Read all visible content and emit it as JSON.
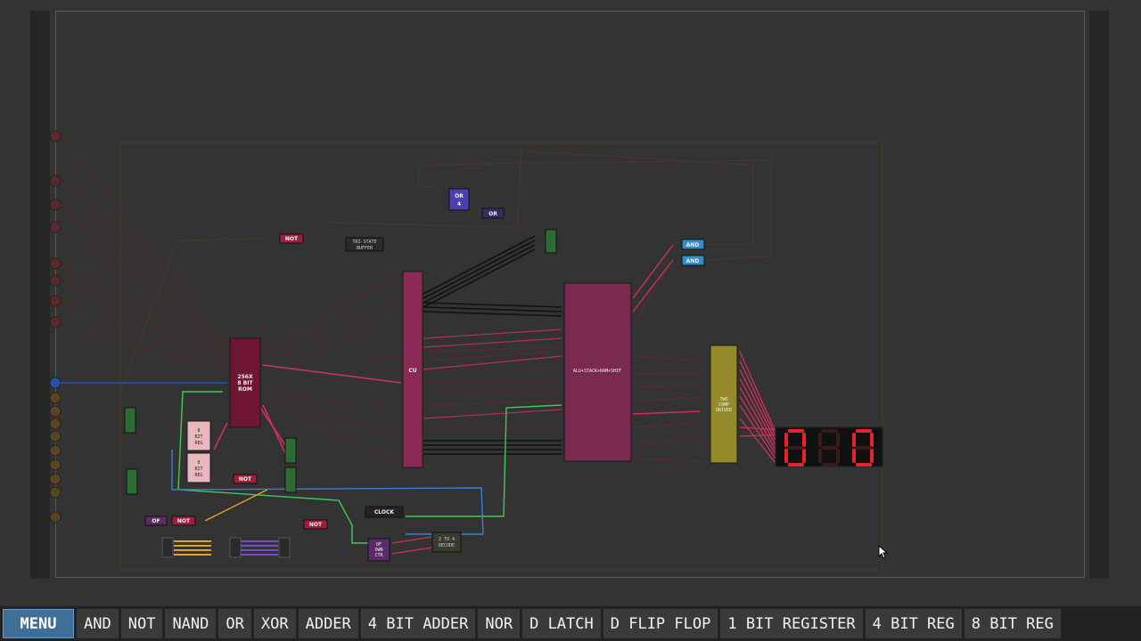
{
  "toolbar": {
    "menu_label": "MENU",
    "items": [
      "AND",
      "NOT",
      "NAND",
      "OR",
      "XOR",
      "ADDER",
      "4 BIT ADDER",
      "NOR",
      "D LATCH",
      "D FLIP FLOP",
      "1 BIT REGISTER",
      "4 BIT REG",
      "8 BIT REG"
    ]
  },
  "chips": {
    "or4_line1": "OR",
    "or4_line2": "4",
    "or": "OR",
    "not": "NOT",
    "tri_state_line1": "TRI-STATE",
    "tri_state_line2": "BUFFER",
    "and": "AND",
    "rom_line1": "256X",
    "rom_line2": "8 BIT",
    "rom_line3": "ROM",
    "cu": "CU",
    "alu": "ALU+STACK+RAM+SHIF",
    "two_comp_line1": "TWO",
    "two_comp_line2": "COMP",
    "two_comp_line3": "DRIVER",
    "reg_line1": "8",
    "reg_line2": "BIT",
    "reg_line3": "REG",
    "clock": "CLOCK",
    "of": "OF",
    "decoder_line1": "2 TO 4",
    "decoder_line2": "DECODE",
    "ovf_line1": "OF",
    "ovf_line2": "OWN",
    "ovf_line3": "CTR"
  },
  "display": {
    "digits": [
      "0",
      "1",
      "0"
    ],
    "lit": [
      true,
      false,
      true
    ]
  },
  "colors": {
    "accent": "#3f6e97",
    "rom": "#6e1634",
    "cu": "#8a2a55",
    "alu": "#7a2a4c",
    "driver": "#958a2a",
    "and_gate": "#2f8fc9",
    "or_gate": "#4b3fb0",
    "not_gate": "#9c1f3c",
    "segment_on": "#e5232e"
  }
}
